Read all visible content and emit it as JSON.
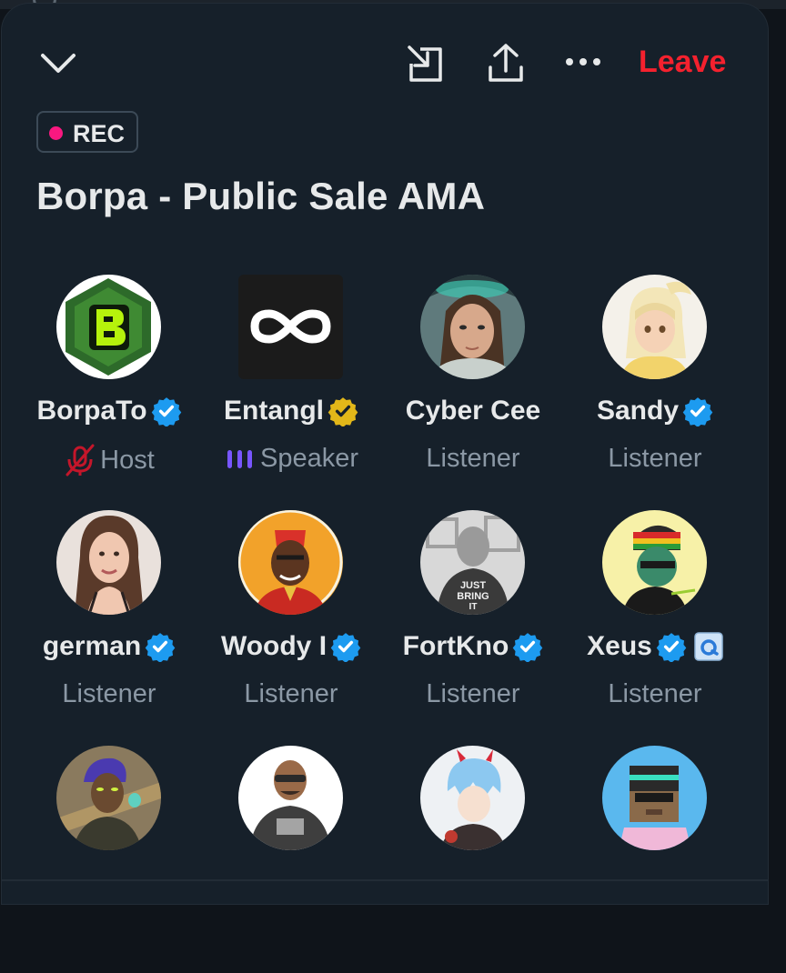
{
  "header": {
    "collapse_icon": "chevron-down-icon",
    "minimize_icon": "minimize-window-icon",
    "share_icon": "share-upload-icon",
    "more_icon": "more-horizontal-icon",
    "leave_label": "Leave",
    "leave_color": "#f4212e"
  },
  "rec_badge": {
    "label": "REC",
    "dot_color": "#f91880"
  },
  "space_title": "Borpa - Public Sale AMA",
  "participants": [
    {
      "name": "BorpaTo",
      "verified": "blue",
      "role": "Host",
      "role_icon": "mic-off-icon"
    },
    {
      "name": "Entangl",
      "verified": "gold",
      "role": "Speaker",
      "role_icon": "speaking-bars-icon"
    },
    {
      "name": "Cyber Cee",
      "verified": "",
      "role": "Listener"
    },
    {
      "name": "Sandy",
      "verified": "blue",
      "role": "Listener"
    },
    {
      "name": "german",
      "verified": "blue",
      "role": "Listener"
    },
    {
      "name": "Woody I",
      "verified": "blue",
      "role": "Listener"
    },
    {
      "name": "FortKno",
      "verified": "blue",
      "role": "Listener"
    },
    {
      "name": "Xeus",
      "verified": "blue",
      "role": "Listener",
      "extra_icon": "affiliate-badge-icon"
    },
    {
      "name": "",
      "role": ""
    },
    {
      "name": "",
      "role": ""
    },
    {
      "name": "",
      "role": ""
    },
    {
      "name": "",
      "role": ""
    }
  ],
  "colors": {
    "verified_blue": "#1d9bf0",
    "verified_gold": "#e2b719",
    "speaker_purple": "#7856ff",
    "mic_off_red": "#c4162a"
  }
}
